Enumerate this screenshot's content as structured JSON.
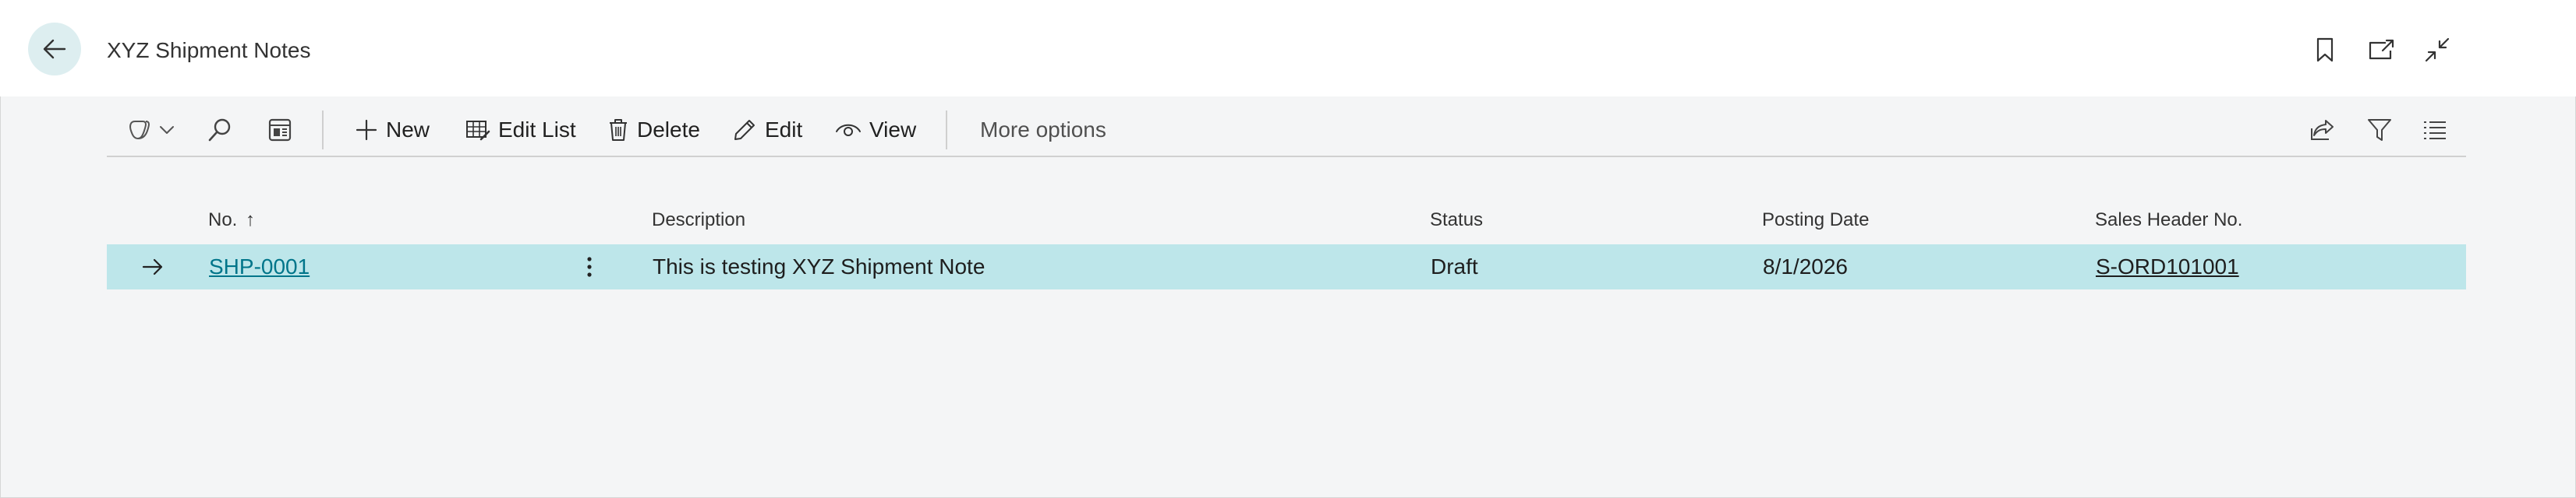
{
  "header": {
    "title": "XYZ Shipment Notes",
    "icons": [
      "back-arrow-icon",
      "bookmark-icon",
      "open-new-window-icon",
      "collapse-icon"
    ]
  },
  "toolbar": {
    "new_label": "New",
    "edit_list_label": "Edit List",
    "delete_label": "Delete",
    "edit_label": "Edit",
    "view_label": "View",
    "more_options_label": "More options"
  },
  "table": {
    "columns": {
      "no": "No.",
      "no_sort": "↑",
      "description": "Description",
      "status": "Status",
      "posting_date": "Posting Date",
      "sales_header_no": "Sales Header No."
    },
    "rows": [
      {
        "no": "SHP-0001",
        "description": "This is testing XYZ Shipment Note",
        "status": "Draft",
        "posting_date": "8/1/2026",
        "sales_header_no": "S-ORD101001",
        "selected": true
      }
    ]
  },
  "colors": {
    "accent": "#00758a",
    "selected_row": "#bde6ea",
    "back_button_bg": "#ddeef0",
    "page_bg": "#f4f5f6"
  }
}
